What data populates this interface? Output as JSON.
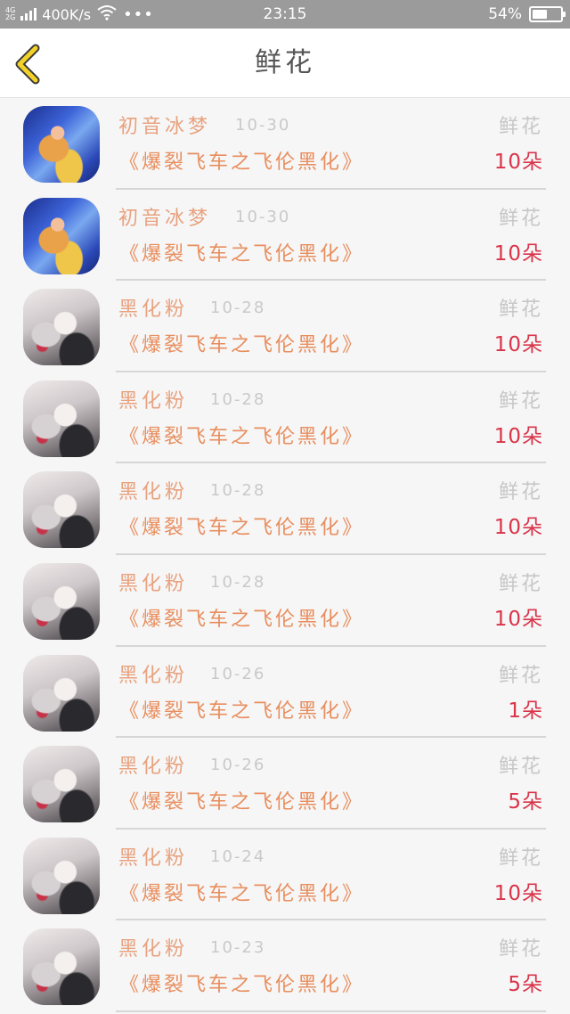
{
  "status_bar": {
    "network": [
      "4G",
      "2G"
    ],
    "speed": "400K/s",
    "wifi_icon": "wifi-icon",
    "dots": "•••",
    "time": "23:15",
    "battery_level": "54%",
    "battery_fraction": 0.54
  },
  "header": {
    "back_icon": "chevron-left-icon",
    "back_color": "#f2d229",
    "title": "鲜花"
  },
  "colors": {
    "name": "#e8a27f",
    "date": "#c9c9c9",
    "book": "#e88e5e",
    "count": "#d9344a",
    "gift_type": "#c7c7c7"
  },
  "items": [
    {
      "avatar": "blue",
      "name": "初音冰梦",
      "date": "10-30",
      "gift": "鲜花",
      "book": "《爆裂飞车之飞伦黑化》",
      "count": "10朵"
    },
    {
      "avatar": "blue",
      "name": "初音冰梦",
      "date": "10-30",
      "gift": "鲜花",
      "book": "《爆裂飞车之飞伦黑化》",
      "count": "10朵"
    },
    {
      "avatar": "pale",
      "name": "黑化粉",
      "date": "10-28",
      "gift": "鲜花",
      "book": "《爆裂飞车之飞伦黑化》",
      "count": "10朵"
    },
    {
      "avatar": "pale",
      "name": "黑化粉",
      "date": "10-28",
      "gift": "鲜花",
      "book": "《爆裂飞车之飞伦黑化》",
      "count": "10朵"
    },
    {
      "avatar": "pale",
      "name": "黑化粉",
      "date": "10-28",
      "gift": "鲜花",
      "book": "《爆裂飞车之飞伦黑化》",
      "count": "10朵"
    },
    {
      "avatar": "pale",
      "name": "黑化粉",
      "date": "10-28",
      "gift": "鲜花",
      "book": "《爆裂飞车之飞伦黑化》",
      "count": "10朵"
    },
    {
      "avatar": "pale",
      "name": "黑化粉",
      "date": "10-26",
      "gift": "鲜花",
      "book": "《爆裂飞车之飞伦黑化》",
      "count": "1朵"
    },
    {
      "avatar": "pale",
      "name": "黑化粉",
      "date": "10-26",
      "gift": "鲜花",
      "book": "《爆裂飞车之飞伦黑化》",
      "count": "5朵"
    },
    {
      "avatar": "pale",
      "name": "黑化粉",
      "date": "10-24",
      "gift": "鲜花",
      "book": "《爆裂飞车之飞伦黑化》",
      "count": "10朵"
    },
    {
      "avatar": "pale",
      "name": "黑化粉",
      "date": "10-23",
      "gift": "鲜花",
      "book": "《爆裂飞车之飞伦黑化》",
      "count": "5朵"
    }
  ]
}
